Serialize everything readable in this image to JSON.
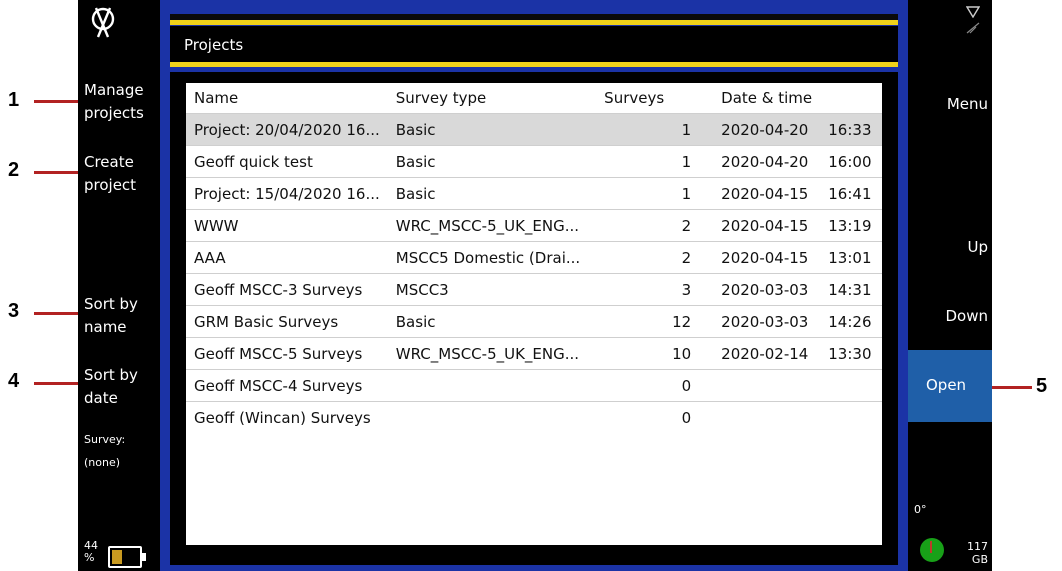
{
  "callouts": [
    "1",
    "2",
    "3",
    "4",
    "5"
  ],
  "left_sidebar": {
    "manage_projects": "Manage\nprojects",
    "create_project": "Create\nproject",
    "sort_by_name": "Sort by\nname",
    "sort_by_date": "Sort by\ndate",
    "survey_label": "Survey:",
    "survey_value": "(none)",
    "battery_percent": "44\n%"
  },
  "header": {
    "title": "Projects"
  },
  "table": {
    "columns": [
      "Name",
      "Survey type",
      "Surveys",
      "Date & time"
    ],
    "rows": [
      {
        "name": "Project: 20/04/2020 16...",
        "type": "Basic",
        "surveys": "1",
        "date": "2020-04-20",
        "time": "16:33"
      },
      {
        "name": "Geoff quick test",
        "type": "Basic",
        "surveys": "1",
        "date": "2020-04-20",
        "time": "16:00"
      },
      {
        "name": "Project: 15/04/2020 16...",
        "type": "Basic",
        "surveys": "1",
        "date": "2020-04-15",
        "time": "16:41"
      },
      {
        "name": "WWW",
        "type": "WRC_MSCC-5_UK_ENG...",
        "surveys": "2",
        "date": "2020-04-15",
        "time": "13:19"
      },
      {
        "name": "AAA",
        "type": "MSCC5 Domestic (Drai...",
        "surveys": "2",
        "date": "2020-04-15",
        "time": "13:01"
      },
      {
        "name": "Geoff MSCC-3 Surveys",
        "type": "MSCC3",
        "surveys": "3",
        "date": "2020-03-03",
        "time": "14:31"
      },
      {
        "name": "GRM Basic Surveys",
        "type": "Basic",
        "surveys": "12",
        "date": "2020-03-03",
        "time": "14:26"
      },
      {
        "name": "Geoff MSCC-5 Surveys",
        "type": "WRC_MSCC-5_UK_ENG...",
        "surveys": "10",
        "date": "2020-02-14",
        "time": "13:30"
      },
      {
        "name": "Geoff MSCC-4 Surveys",
        "type": "",
        "surveys": "0",
        "date": "",
        "time": ""
      },
      {
        "name": "Geoff (Wincan) Surveys",
        "type": "",
        "surveys": "0",
        "date": "",
        "time": ""
      }
    ],
    "selected_row": 0
  },
  "right_sidebar": {
    "menu": "Menu",
    "up": "Up",
    "down": "Down",
    "open": "Open",
    "angle": "0°",
    "storage": "117\nGB"
  },
  "colors": {
    "screen_blue": "#1b33a6",
    "yellow_accent": "#f0d21a",
    "open_button": "#1f5fa8",
    "callout_line": "#b22222"
  },
  "icons": [
    "logo-icon",
    "battery-icon",
    "wifi-icon",
    "gps-signal-icon",
    "status-indicator-icon"
  ]
}
